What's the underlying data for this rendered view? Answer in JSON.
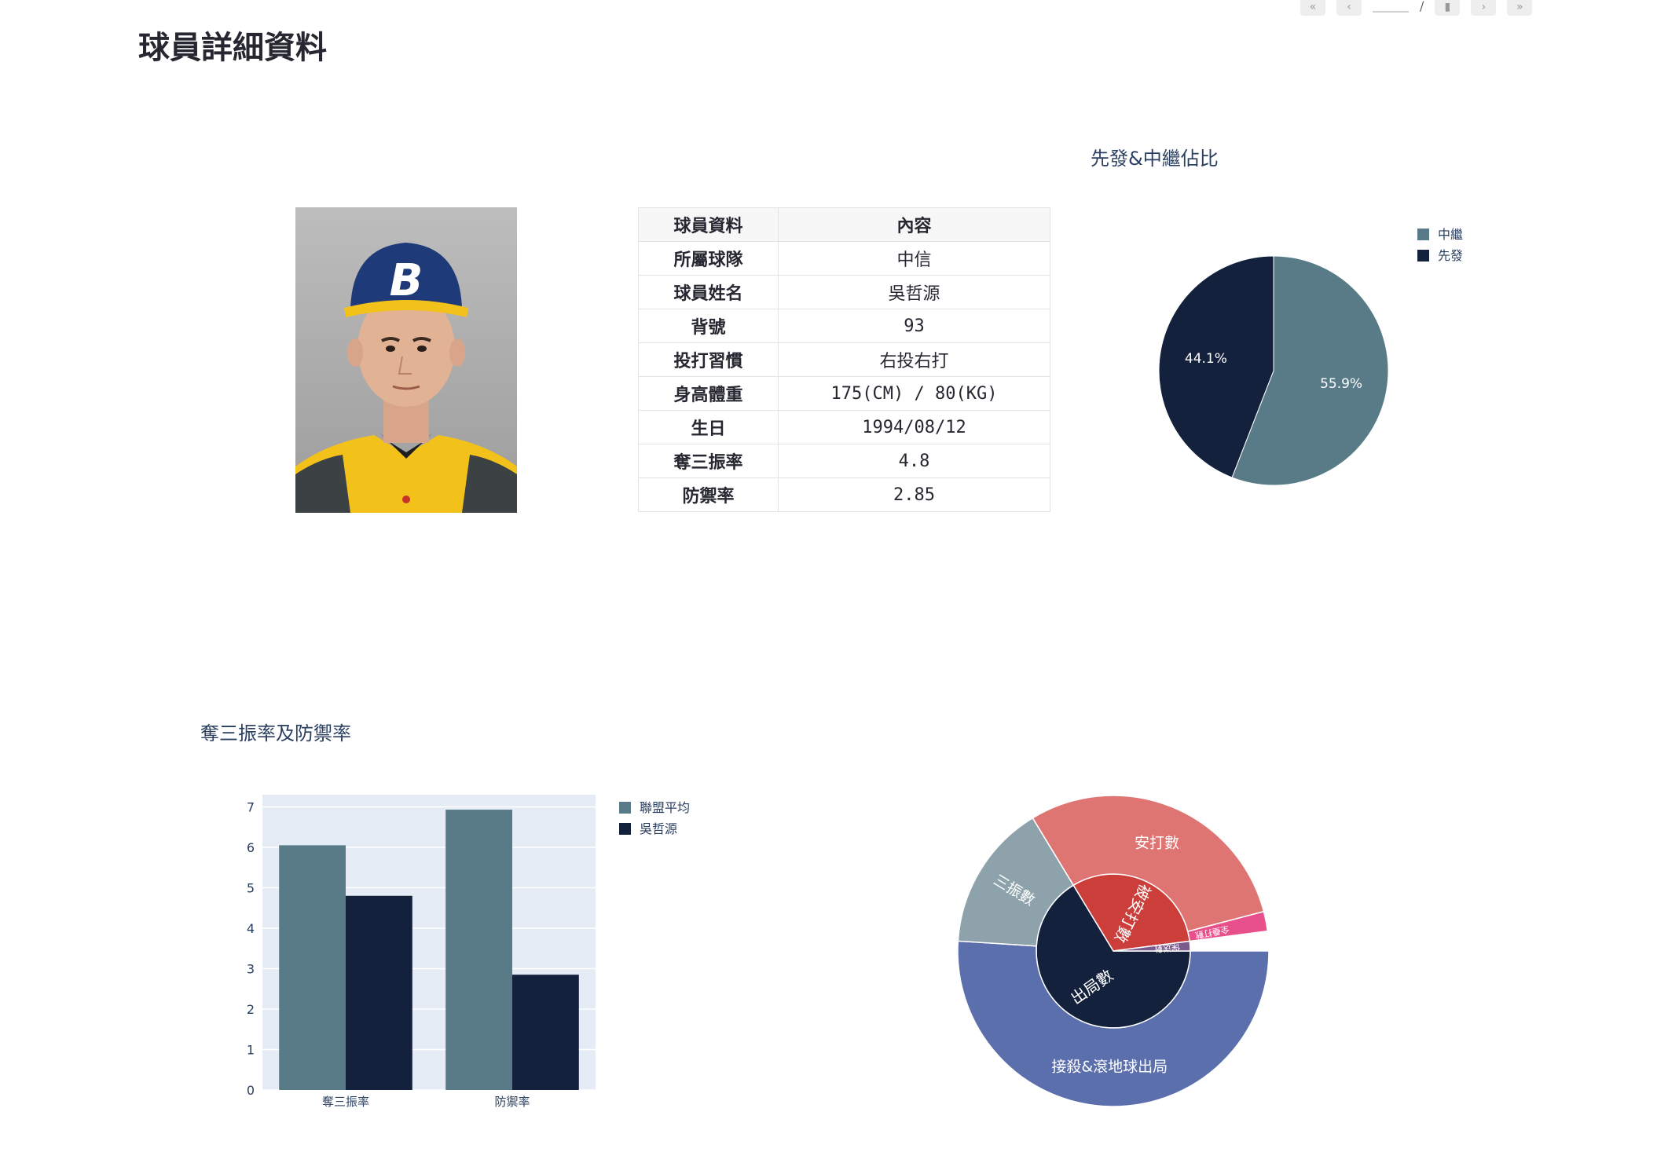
{
  "page_title": "球員詳細資料",
  "toolbar": {
    "separator": "/"
  },
  "player_photo": {
    "cap_letter": "B"
  },
  "player_table": {
    "headers": [
      "球員資料",
      "內容"
    ],
    "rows": [
      [
        "所屬球隊",
        "中信"
      ],
      [
        "球員姓名",
        "吳哲源"
      ],
      [
        "背號",
        "93"
      ],
      [
        "投打習慣",
        "右投右打"
      ],
      [
        "身高體重",
        "175(CM) / 80(KG)"
      ],
      [
        "生日",
        "1994/08/12"
      ],
      [
        "奪三振率",
        "4.8"
      ],
      [
        "防禦率",
        "2.85"
      ]
    ]
  },
  "colors": {
    "relief": "#587B87",
    "starter": "#14213D",
    "plot_bg": "#E5ECF6",
    "sunburst_outs": "#14213D",
    "sunburst_groundfly": "#5B6FAD",
    "sunburst_strikeout": "#8DA2AA",
    "sunburst_hits_inner": "#CC3E3A",
    "sunburst_hits": "#DE7572",
    "sunburst_hr": "#E7508A",
    "sunburst_walk": "#7B5A8E"
  },
  "chart_data": [
    {
      "type": "pie",
      "title": "先發&中繼佔比",
      "labels": [
        "中繼",
        "先發"
      ],
      "values": [
        55.9,
        44.1
      ],
      "legend": [
        "中繼",
        "先發"
      ],
      "legend_position": "top-right"
    },
    {
      "type": "bar",
      "title": "奪三振率及防禦率",
      "categories": [
        "奪三振率",
        "防禦率"
      ],
      "series": [
        {
          "name": "聯盟平均",
          "values": [
            6.05,
            6.93
          ]
        },
        {
          "name": "吳哲源",
          "values": [
            4.8,
            2.85
          ]
        }
      ],
      "ylim": [
        0,
        7.3
      ],
      "yticks": [
        0,
        1,
        2,
        3,
        4,
        5,
        6,
        7
      ],
      "grid": true,
      "legend_position": "top-right"
    },
    {
      "type": "sunburst",
      "nodes": [
        {
          "id": "outs",
          "label": "出局數",
          "parent": "",
          "value": 65
        },
        {
          "id": "groundfly",
          "label": "接殺&滾地球出局",
          "parent": "outs",
          "value": 50
        },
        {
          "id": "strikeout",
          "label": "三振數",
          "parent": "outs",
          "value": 15
        },
        {
          "id": "hits_inner",
          "label": "被安打數",
          "parent": "",
          "value": 31
        },
        {
          "id": "hits",
          "label": "安打數",
          "parent": "hits_inner",
          "value": 29
        },
        {
          "id": "hr",
          "label": "全壘打數",
          "parent": "hits_inner",
          "value": 2
        },
        {
          "id": "walk",
          "label": "保送數",
          "parent": "",
          "value": 2
        }
      ]
    }
  ]
}
